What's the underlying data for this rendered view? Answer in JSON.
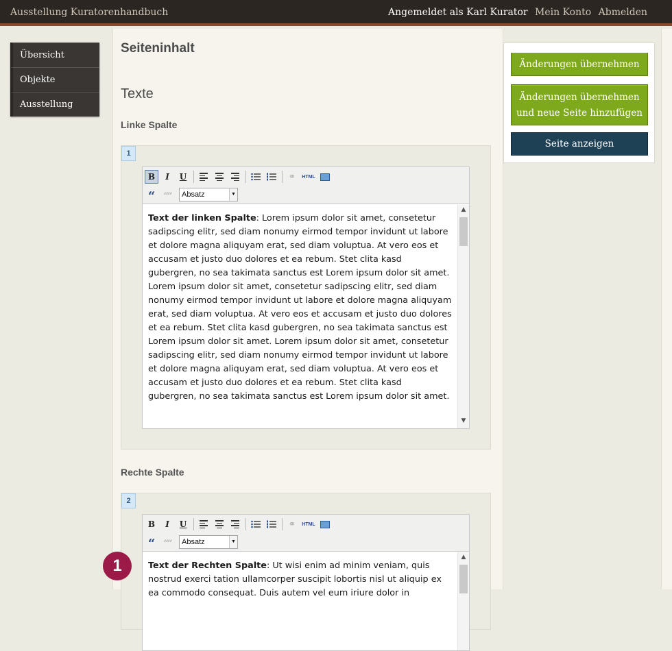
{
  "header": {
    "app_title": "Ausstellung Kuratorenhandbuch",
    "logged_in_as": "Angemeldet als Karl Kurator",
    "account_link": "Mein Konto",
    "logout_link": "Abmelden"
  },
  "nav": {
    "items": [
      {
        "label": "Übersicht"
      },
      {
        "label": "Objekte"
      },
      {
        "label": "Ausstellung"
      }
    ]
  },
  "main": {
    "page_title": "Seiteninhalt",
    "section_title": "Texte",
    "columns": [
      {
        "heading": "Linke Spalte",
        "number": "1",
        "format": "Absatz",
        "lead": "Text der linken Spalte",
        "body": ": Lorem ipsum dolor sit amet, consetetur sadipscing elitr, sed diam nonumy eirmod tempor invidunt ut labore et dolore magna aliquyam erat, sed diam voluptua. At vero eos et accusam et justo duo dolores et ea rebum. Stet clita kasd gubergren, no sea takimata sanctus est Lorem ipsum dolor sit amet. Lorem ipsum dolor sit amet, consetetur sadipscing elitr, sed diam nonumy eirmod tempor invidunt ut labore et dolore magna aliquyam erat, sed diam voluptua. At vero eos et accusam et justo duo dolores et ea rebum. Stet clita kasd gubergren, no sea takimata sanctus est Lorem ipsum dolor sit amet. Lorem ipsum dolor sit amet, consetetur sadipscing elitr, sed diam nonumy eirmod tempor invidunt ut labore et dolore magna aliquyam erat, sed diam voluptua. At vero eos et accusam et justo duo dolores et ea rebum. Stet clita kasd gubergren, no sea takimata sanctus est Lorem ipsum dolor sit amet."
      },
      {
        "heading": "Rechte Spalte",
        "number": "2",
        "format": "Absatz",
        "lead": "Text der Rechten Spalte",
        "body": ": Ut wisi enim ad minim veniam, quis nostrud exerci tation ullamcorper suscipit lobortis nisl ut aliquip ex ea commodo consequat. Duis autem vel eum iriure dolor in"
      }
    ],
    "toolbar": {
      "bold": "B",
      "italic": "I",
      "underline": "U",
      "html": "HTML",
      "quote": "“",
      "unquote": "“”"
    }
  },
  "actions": {
    "apply": "Änderungen übernehmen",
    "apply_new_line1": "Änderungen übernehmen",
    "apply_new_line2": "und neue Seite hinzufügen",
    "view": "Seite anzeigen"
  },
  "callout": "1",
  "colors": {
    "topbar": "#2b2622",
    "accent_rule": "#8a4a2e",
    "green_button": "#7fa91c",
    "navy_button": "#1e4156",
    "callout": "#9c1a47"
  }
}
